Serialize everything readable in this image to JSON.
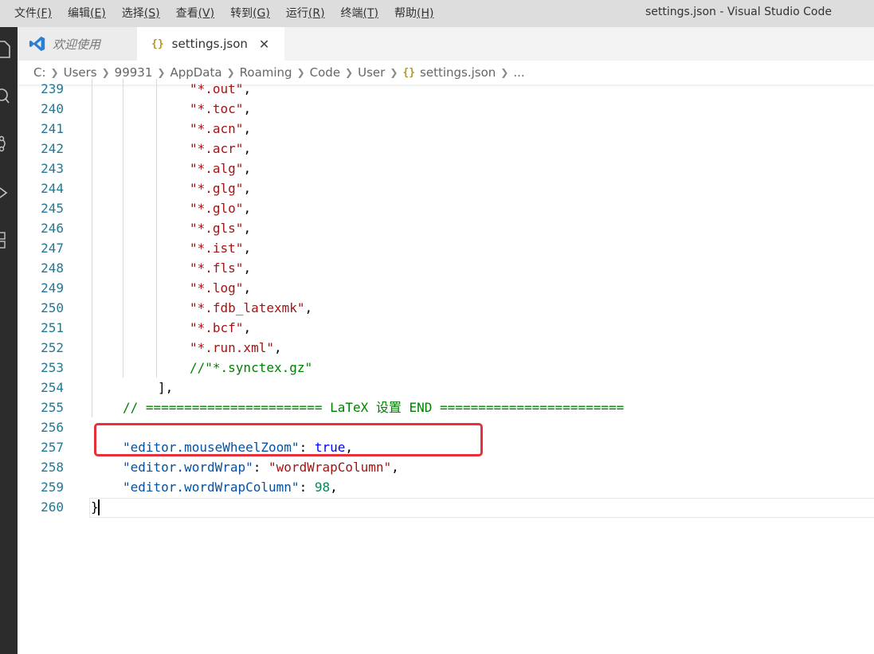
{
  "window": {
    "title": "settings.json - Visual Studio Code"
  },
  "menu": [
    {
      "label": "文件",
      "key": "(F)"
    },
    {
      "label": "编辑",
      "key": "(E)"
    },
    {
      "label": "选择",
      "key": "(S)"
    },
    {
      "label": "查看",
      "key": "(V)"
    },
    {
      "label": "转到",
      "key": "(G)"
    },
    {
      "label": "运行",
      "key": "(R)"
    },
    {
      "label": "终端",
      "key": "(T)"
    },
    {
      "label": "帮助",
      "key": "(H)"
    }
  ],
  "tabs": [
    {
      "label": "欢迎使用"
    },
    {
      "label": "settings.json",
      "icon": "{}"
    }
  ],
  "close_glyph": "✕",
  "breadcrumb": {
    "items": [
      "C:",
      "Users",
      "99931",
      "AppData",
      "Roaming",
      "Code",
      "User",
      "settings.json",
      "..."
    ],
    "file_icon": "{}"
  },
  "editor": {
    "lines": [
      {
        "n": "239",
        "text": "\"*.out\",",
        "kind": "str"
      },
      {
        "n": "240",
        "text": "\"*.toc\",",
        "kind": "str"
      },
      {
        "n": "241",
        "text": "\"*.acn\",",
        "kind": "str"
      },
      {
        "n": "242",
        "text": "\"*.acr\",",
        "kind": "str"
      },
      {
        "n": "243",
        "text": "\"*.alg\",",
        "kind": "str"
      },
      {
        "n": "244",
        "text": "\"*.glg\",",
        "kind": "str"
      },
      {
        "n": "245",
        "text": "\"*.glo\",",
        "kind": "str"
      },
      {
        "n": "246",
        "text": "\"*.gls\",",
        "kind": "str"
      },
      {
        "n": "247",
        "text": "\"*.ist\",",
        "kind": "str"
      },
      {
        "n": "248",
        "text": "\"*.fls\",",
        "kind": "str"
      },
      {
        "n": "249",
        "text": "\"*.log\",",
        "kind": "str"
      },
      {
        "n": "250",
        "text": "\"*.fdb_latexmk\",",
        "kind": "str"
      },
      {
        "n": "251",
        "text": "\"*.bcf\",",
        "kind": "str"
      },
      {
        "n": "252",
        "text": "\"*.run.xml\",",
        "kind": "str"
      },
      {
        "n": "253",
        "text": "//\"*.synctex.gz\"",
        "kind": "cmt"
      },
      {
        "n": "254",
        "text": "],",
        "kind": "plain"
      },
      {
        "n": "255",
        "text": "// ======================= LaTeX 设置 END ========================",
        "kind": "cmt"
      },
      {
        "n": "256",
        "text": "",
        "kind": "plain"
      },
      {
        "n": "257",
        "key": "\"editor.mouseWheelZoom\"",
        "colon": ": ",
        "value": "true",
        "vkind": "kw",
        "tail": ","
      },
      {
        "n": "258",
        "key": "\"editor.wordWrap\"",
        "colon": ": ",
        "value": "\"wordWrapColumn\"",
        "vkind": "str",
        "tail": ","
      },
      {
        "n": "259",
        "key": "\"editor.wordWrapColumn\"",
        "colon": ": ",
        "value": "98",
        "vkind": "num",
        "tail": ","
      },
      {
        "n": "260",
        "text": "}",
        "kind": "plain"
      }
    ]
  }
}
